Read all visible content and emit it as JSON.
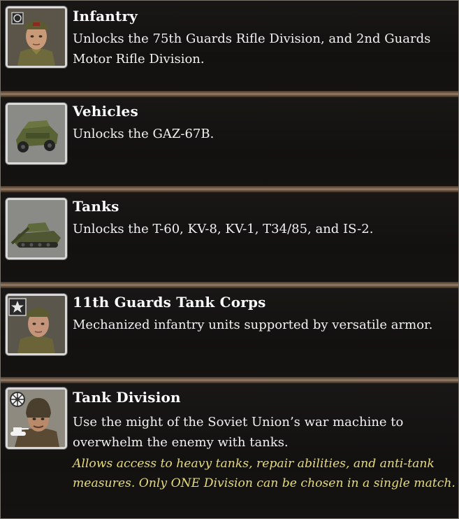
{
  "items": [
    {
      "title": "Infantry",
      "description": "Unlocks the 75th Guards Rifle Division, and 2nd Guards Motor Rifle Division.",
      "icon": "soldier-portrait-icon"
    },
    {
      "title": "Vehicles",
      "description": "Unlocks the GAZ-67B.",
      "icon": "jeep-icon"
    },
    {
      "title": "Tanks",
      "description": "Unlocks the T-60, KV-8, KV-1, T34/85, and IS-2.",
      "icon": "tank-icon"
    },
    {
      "title": "11th Guards Tank Corps",
      "description": "Mechanized infantry units supported by versatile armor.",
      "icon": "officer-star-portrait-icon"
    },
    {
      "title": "Tank Division",
      "description": "Use the might of the Soviet Union’s war machine to overwhelm the enemy with tanks.",
      "note": "Allows access to heavy tanks, repair abilities, and anti-tank measures. Only ONE Division can be chosen in a single match.",
      "icon": "tank-commander-portrait-icon"
    }
  ],
  "colors": {
    "title": "#ffffff",
    "description": "#f2f2f2",
    "note": "#e7dc7a",
    "divider": "#8a735e"
  }
}
